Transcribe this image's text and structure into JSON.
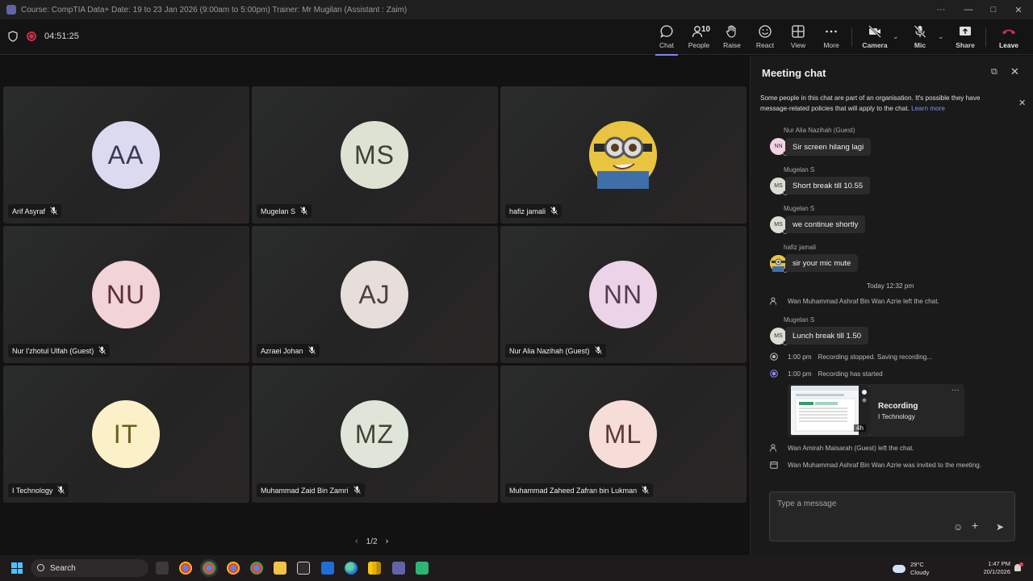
{
  "window": {
    "title": "Course: CompTIA Data+ Date: 19 to 23 Jan 2026 (9:00am to 5:00pm) Trainer: Mr Mugilan (Assistant : Zaim)",
    "more": "···",
    "minimize": "—",
    "maximize": "□",
    "close": "✕"
  },
  "meeting": {
    "timer": "04:51:25",
    "people_count": "10",
    "toolbar": {
      "chat": "Chat",
      "people": "People",
      "raise": "Raise",
      "react": "React",
      "view": "View",
      "more": "More",
      "camera": "Camera",
      "mic": "Mic",
      "share": "Share",
      "leave": "Leave"
    },
    "chevron": "⌄",
    "colors": {
      "accent": "#7f85f5",
      "leave": "#c4314b"
    }
  },
  "participants": [
    {
      "initials": "AA",
      "name": "Arif Asyraf",
      "avatar_color": "#dcdaf0",
      "initials_color": "#3a3a55"
    },
    {
      "initials": "MS",
      "name": "Mugelan S",
      "avatar_color": "#dde2d3",
      "initials_color": "#3b4236"
    },
    {
      "initials": "",
      "name": "hafiz jamali",
      "avatar_color": "#e8c440",
      "initials_color": "#333"
    },
    {
      "initials": "NU",
      "name": "Nur I'zhotul Ulfah (Guest)",
      "avatar_color": "#f1d3d8",
      "initials_color": "#5a2e36"
    },
    {
      "initials": "AJ",
      "name": "Azraei Johan",
      "avatar_color": "#e7dedc",
      "initials_color": "#4d3f3d"
    },
    {
      "initials": "NN",
      "name": "Nur Alia Nazihah (Guest)",
      "avatar_color": "#ecd4e8",
      "initials_color": "#563b52"
    },
    {
      "initials": "IT",
      "name": "I Technology",
      "avatar_color": "#fbf0c7",
      "initials_color": "#6e5b1d"
    },
    {
      "initials": "MZ",
      "name": "Muhammad Zaid Bin Zamri",
      "avatar_color": "#dfe5d8",
      "initials_color": "#3e4636"
    },
    {
      "initials": "ML",
      "name": "Muhammad Zaheed Zafran bin Lukman",
      "avatar_color": "#f6ddd8",
      "initials_color": "#5c3a33"
    }
  ],
  "pager": {
    "label": "1/2",
    "prev": "‹",
    "next": "›"
  },
  "chat": {
    "title": "Meeting chat",
    "popout": "⧉",
    "close": "✕",
    "notice": "Some people in this chat are part of an organisation. It's possible they have message-related policies that will apply to the chat.",
    "learn_more": "Learn more",
    "messages": [
      {
        "sender": "Nur Alia Nazihah (Guest)",
        "initials": "NN",
        "text": "Sir screen hilang lagi"
      },
      {
        "sender": "Mugelan S",
        "initials": "MS",
        "text": "Short break till 10.55"
      },
      {
        "sender": "Mugelan S",
        "initials": "MS",
        "text": "we continue shortly"
      },
      {
        "sender": "hafiz jamali",
        "initials": "",
        "text": "sir your mic mute"
      }
    ],
    "day_divider": "Today 12:32 pm",
    "system_left_1": "Wan Muhammad Ashraf Bin Wan Azrie left the chat.",
    "msg5": {
      "sender": "Mugelan S",
      "initials": "MS",
      "text": "Lunch break till 1.50"
    },
    "rec_stopped": {
      "time": "1:00 pm",
      "text": "Recording stopped. Saving recording..."
    },
    "rec_started": {
      "time": "1:00 pm",
      "text": "Recording has started"
    },
    "recording_card": {
      "title": "Recording",
      "subtitle": "I Technology",
      "duration": "4h",
      "more": "···"
    },
    "system_left_2": "Wan Amirah Maisarah (Guest) left the chat.",
    "system_invited": "Wan Muhammad Ashraf Bin Wan Azrie was invited to the meeting.",
    "composer_placeholder": "Type a message",
    "emoji": "☺",
    "attach": "+",
    "send": "➤"
  },
  "taskbar": {
    "search": "Search",
    "temperature": "29°C",
    "condition": "Cloudy",
    "time": "1:47 PM",
    "date": "20/1/2026"
  }
}
